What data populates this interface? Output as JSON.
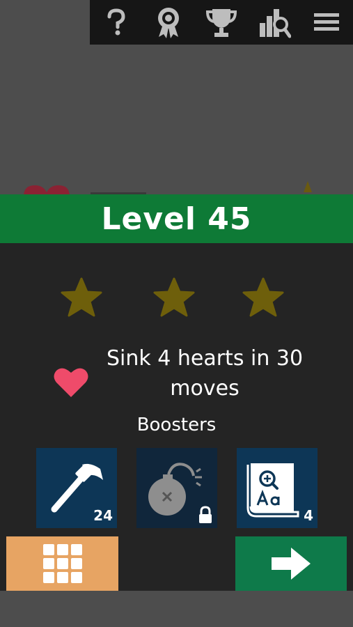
{
  "topbar": {
    "icons": [
      "help-icon",
      "badge-icon",
      "trophy-icon",
      "leaderboard-search-icon",
      "menu-icon"
    ]
  },
  "level": {
    "title": "Level 45"
  },
  "stars": {
    "earned": 0,
    "total": 3,
    "color_empty": "#6e5f0b"
  },
  "goal": {
    "icon": "heart-icon",
    "text": "Sink 4 hearts in 30 moves",
    "heart_color": "#ef4b6a"
  },
  "boosters": {
    "title": "Boosters",
    "items": [
      {
        "icon": "hammer-icon",
        "count": "24",
        "locked": false
      },
      {
        "icon": "bomb-icon",
        "count": "",
        "locked": true
      },
      {
        "icon": "dictionary-icon",
        "count": "4",
        "locked": false
      }
    ]
  },
  "buttons": {
    "grid": "level-grid-icon",
    "play": "arrow-right-icon"
  },
  "colors": {
    "banner": "#0e7a36",
    "panel": "#242424",
    "grid_button": "#e7a463",
    "play_button": "#0e7a4a",
    "booster_tile": "#0d3656"
  }
}
